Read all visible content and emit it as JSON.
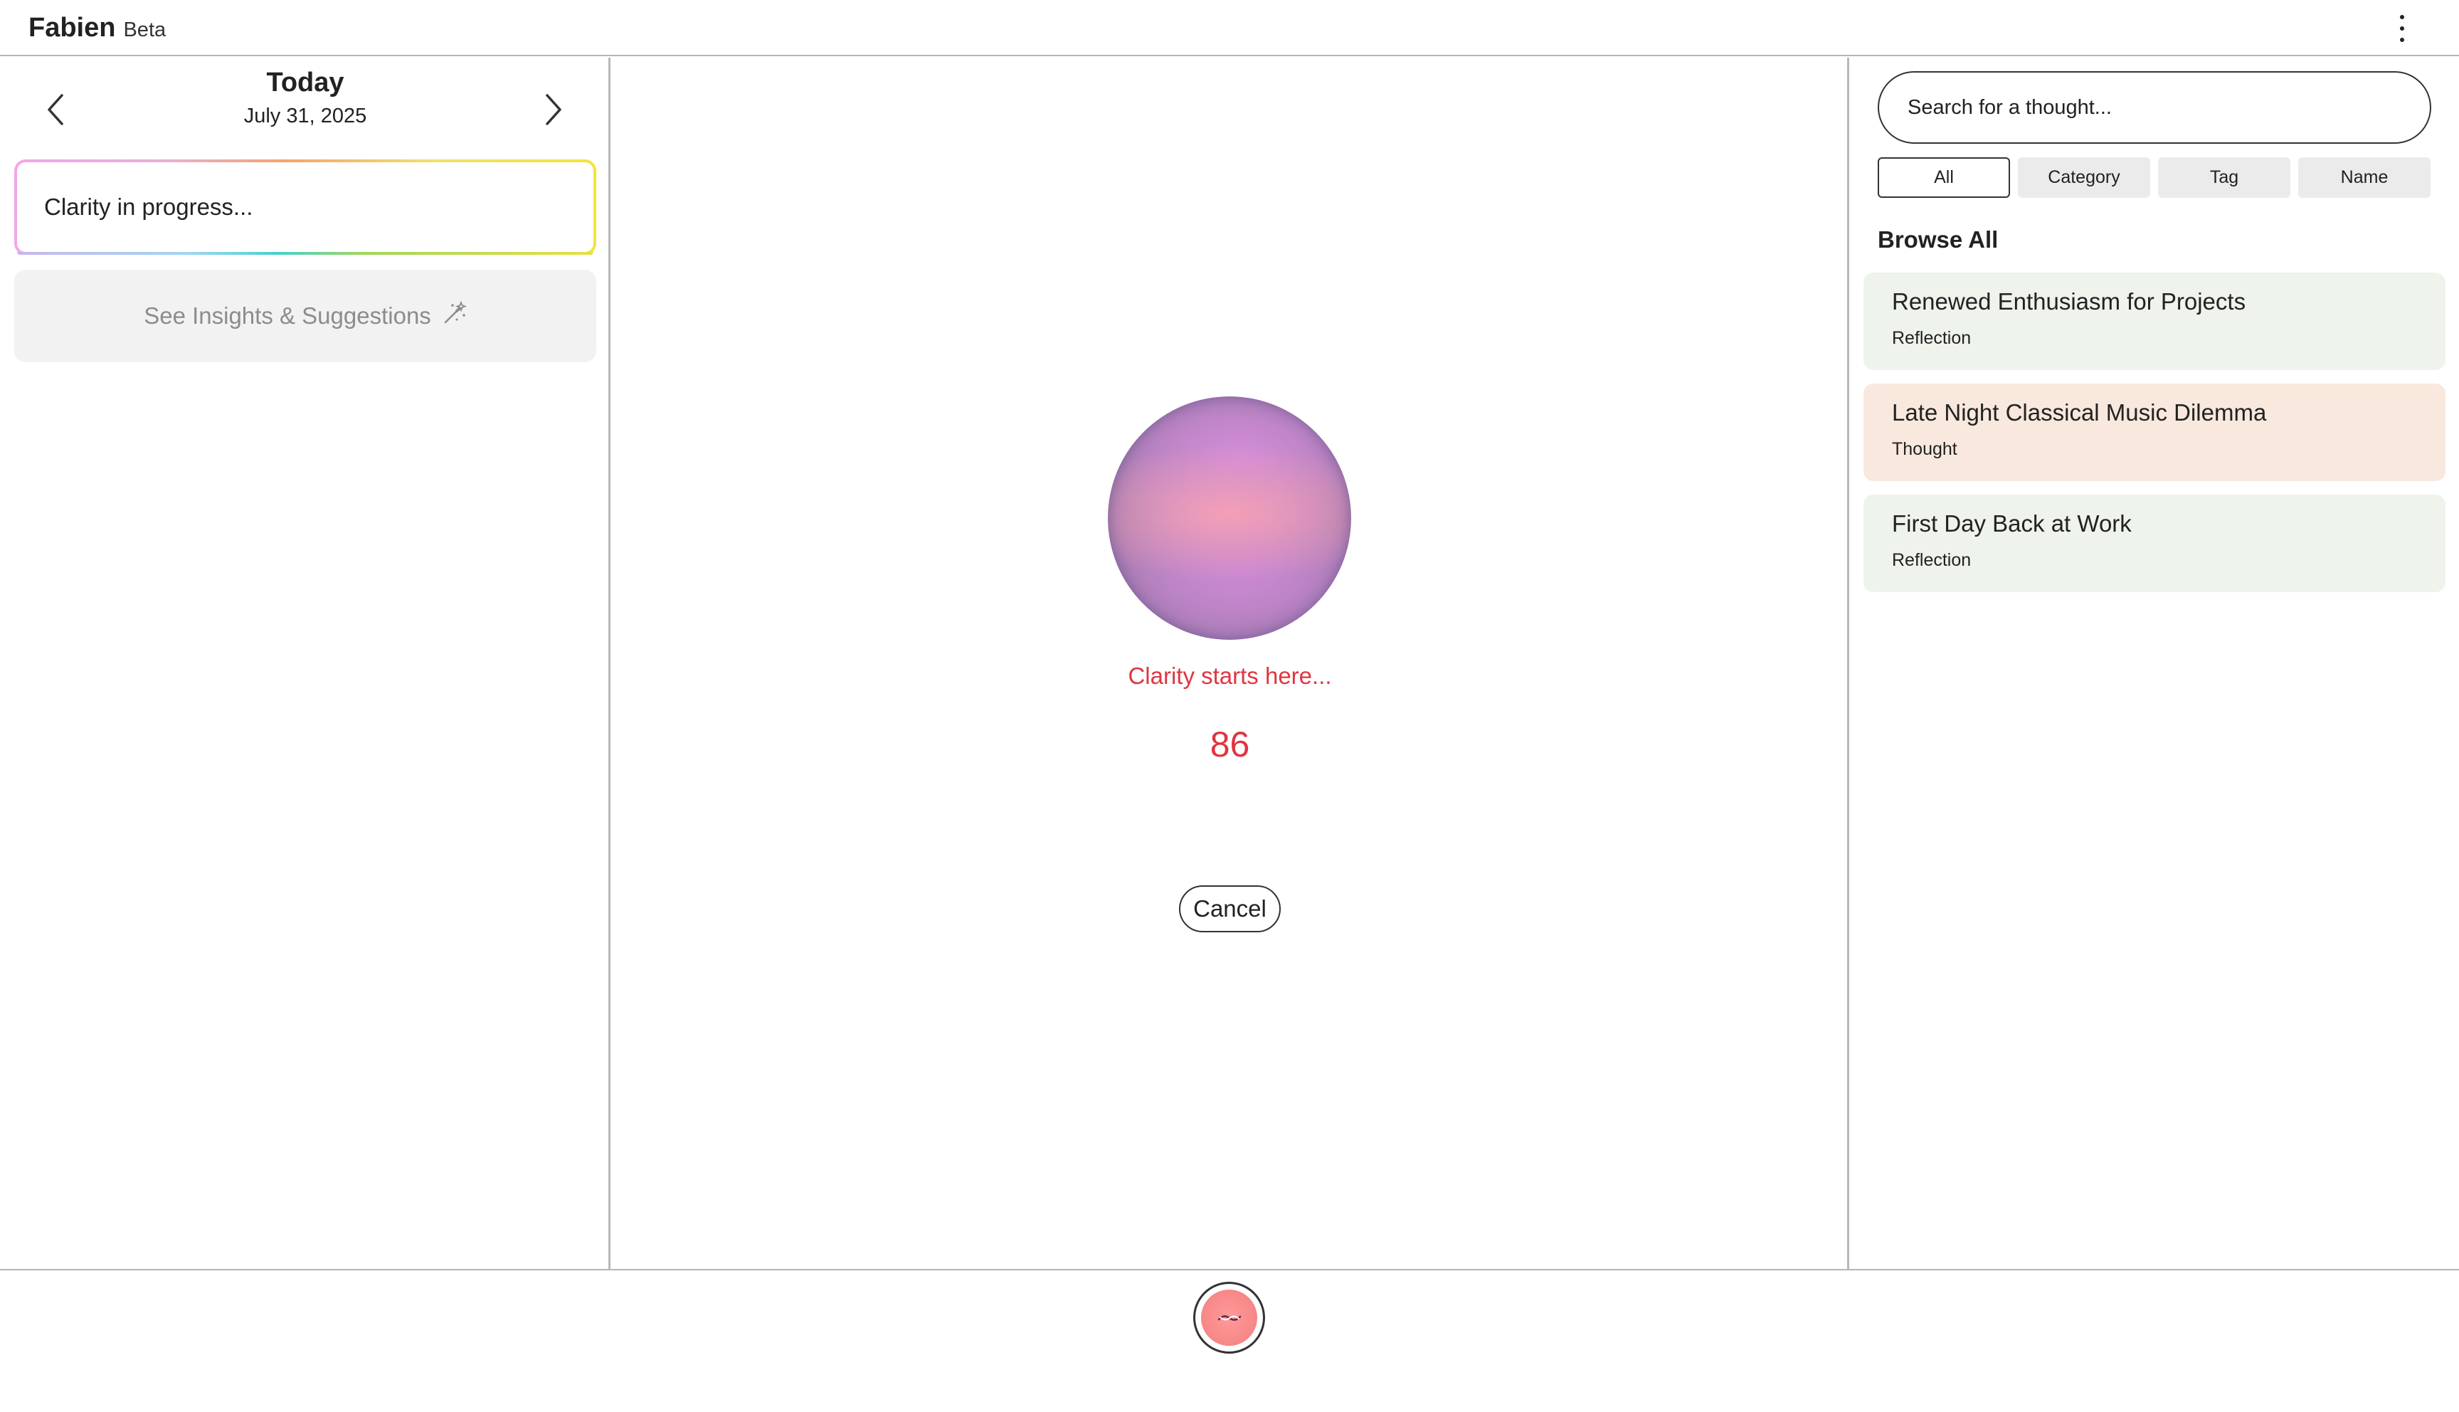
{
  "app": {
    "name": "Fabien",
    "badge": "Beta",
    "menu_icon": "more-vertical-icon"
  },
  "day_nav": {
    "title": "Today",
    "date": "July 31, 2025",
    "prev_icon": "chevron-left-icon",
    "next_icon": "chevron-right-icon"
  },
  "entry": {
    "status_text": "Clarity in progress..."
  },
  "insights": {
    "label": "See Insights & Suggestions",
    "icon": "magic-wand-icon"
  },
  "center": {
    "status_text": "Clarity starts here...",
    "count": "86",
    "cancel_label": "Cancel",
    "status_color": "#e0353f"
  },
  "search": {
    "placeholder": "Search for a thought..."
  },
  "filters": [
    {
      "label": "All",
      "active": true
    },
    {
      "label": "Category",
      "active": false
    },
    {
      "label": "Tag",
      "active": false
    },
    {
      "label": "Name",
      "active": false
    }
  ],
  "browse": {
    "heading": "Browse All",
    "items": [
      {
        "title": "Renewed Enthusiasm for Projects",
        "category": "Reflection",
        "color": "#eef3ec"
      },
      {
        "title": "Late Night Classical Music Dilemma",
        "category": "Thought",
        "color": "#f8e8dd"
      },
      {
        "title": "First Day Back at Work",
        "category": "Reflection",
        "color": "#eef3ec"
      }
    ]
  },
  "footer": {
    "record_icon": "record-orb-icon"
  }
}
